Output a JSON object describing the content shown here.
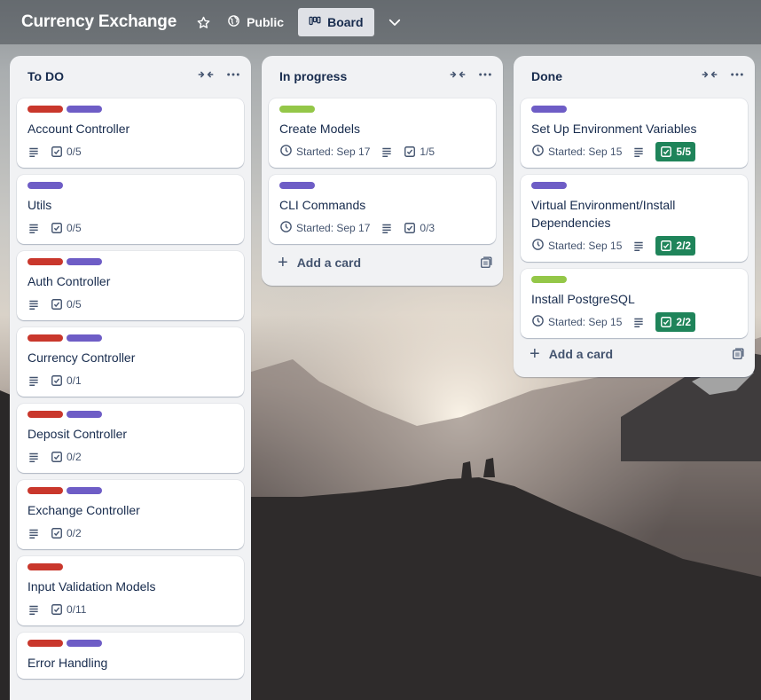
{
  "header": {
    "title": "Currency Exchange",
    "star_icon": "star-icon",
    "visibility_label": "Public",
    "view_label": "Board",
    "more_views_icon": "chevron-down-icon"
  },
  "colors": {
    "red": "#c9372c",
    "purple": "#6e5dc6",
    "green": "#94c748",
    "done_badge": "#1f845a"
  },
  "lists": [
    {
      "title": "To DO",
      "add_card_label": "Add a card",
      "cards": [
        {
          "title": "Account Controller",
          "labels": [
            "red",
            "purple"
          ],
          "checklist": "0/5"
        },
        {
          "title": "Utils",
          "labels": [
            "purple"
          ],
          "checklist": "0/5"
        },
        {
          "title": "Auth Controller",
          "labels": [
            "red",
            "purple"
          ],
          "checklist": "0/5"
        },
        {
          "title": "Currency Controller",
          "labels": [
            "red",
            "purple"
          ],
          "checklist": "0/1"
        },
        {
          "title": "Deposit Controller",
          "labels": [
            "red",
            "purple"
          ],
          "checklist": "0/2"
        },
        {
          "title": "Exchange Controller",
          "labels": [
            "red",
            "purple"
          ],
          "checklist": "0/2"
        },
        {
          "title": "Input Validation Models",
          "labels": [
            "red"
          ],
          "checklist": "0/11"
        },
        {
          "title": "Error Handling",
          "labels": [
            "red",
            "purple"
          ]
        }
      ]
    },
    {
      "title": "In progress",
      "add_card_label": "Add a card",
      "cards": [
        {
          "title": "Create Models",
          "labels": [
            "green"
          ],
          "started": "Started: Sep 17",
          "checklist": "1/5"
        },
        {
          "title": "CLI Commands",
          "labels": [
            "purple"
          ],
          "started": "Started: Sep 17",
          "checklist": "0/3"
        }
      ]
    },
    {
      "title": "Done",
      "add_card_label": "Add a card",
      "cards": [
        {
          "title": "Set Up Environment Variables",
          "labels": [
            "purple"
          ],
          "started": "Started: Sep 15",
          "checklist": "5/5",
          "complete": true
        },
        {
          "title": "Virtual Environment/Install Dependencies",
          "labels": [
            "purple"
          ],
          "started": "Started: Sep 15",
          "checklist": "2/2",
          "complete": true
        },
        {
          "title": "Install PostgreSQL",
          "labels": [
            "green"
          ],
          "started": "Started: Sep 15",
          "checklist": "2/2",
          "complete": true
        }
      ]
    }
  ]
}
